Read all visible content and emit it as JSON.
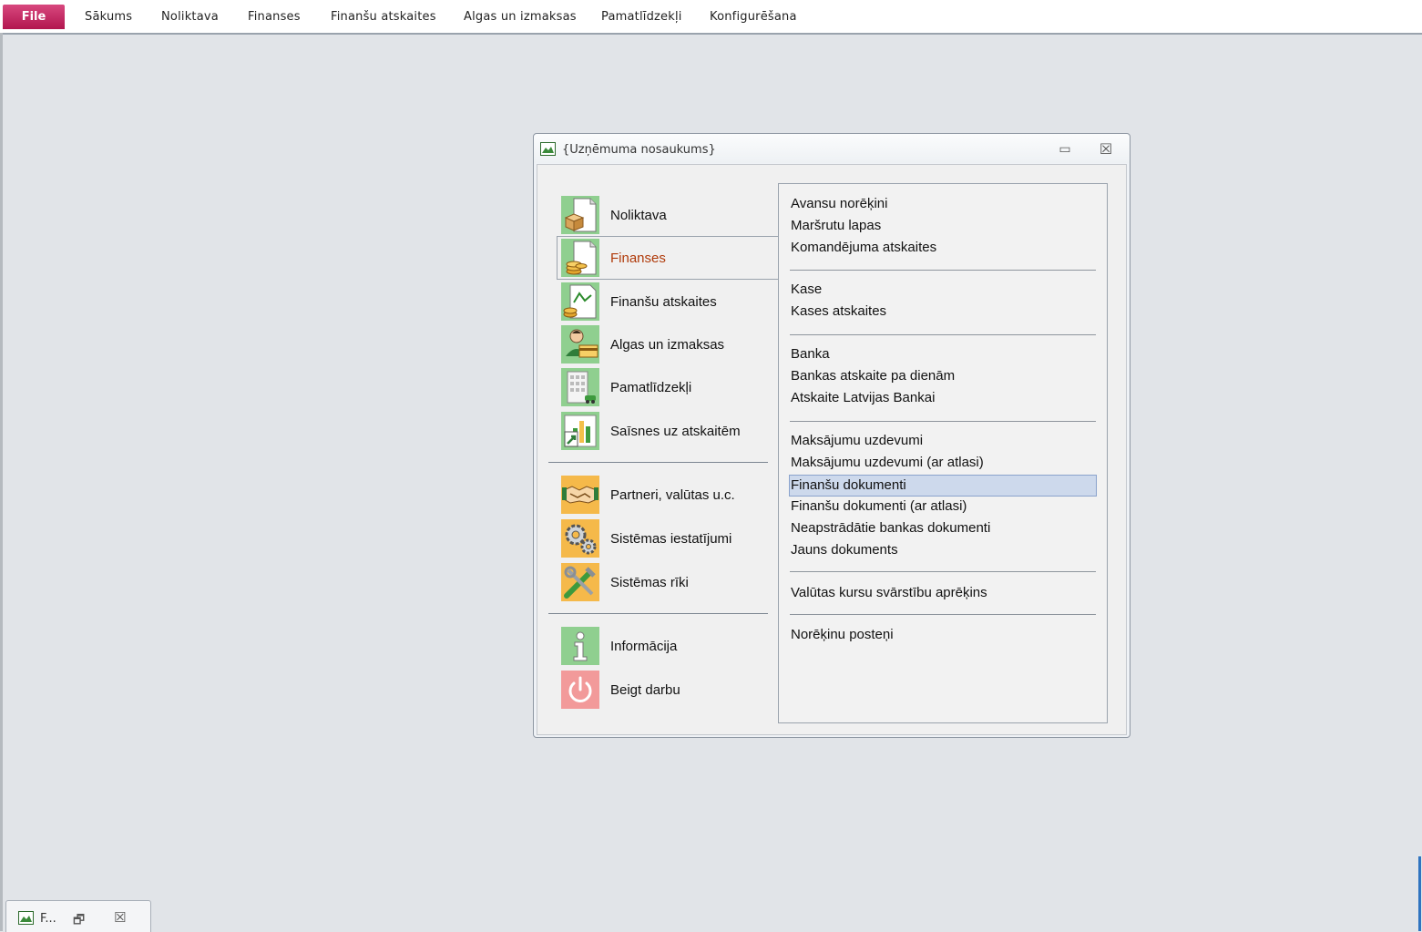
{
  "ribbon": {
    "file_label": "File",
    "tabs": [
      "Sākums",
      "Noliktava",
      "Finanses",
      "Finanšu atskaites",
      "Algas un izmaksas",
      "Pamatlīdzekļi",
      "Konfigurēšana"
    ]
  },
  "window": {
    "title": "{Uzņēmuma nosaukums}",
    "minimize_glyph": "▭",
    "close_glyph": "☒"
  },
  "nav": {
    "items": [
      {
        "label": "Noliktava",
        "icon": "warehouse-box-icon"
      },
      {
        "label": "Finanses",
        "icon": "finance-coins-icon"
      },
      {
        "label": "Finanšu atskaites",
        "icon": "finance-report-chart-icon"
      },
      {
        "label": "Algas un izmaksas",
        "icon": "salary-person-card-icon"
      },
      {
        "label": "Pamatlīdzekļi",
        "icon": "fixed-assets-building-icon"
      },
      {
        "label": "Saīsnes uz atskaitēm",
        "icon": "report-shortcut-icon"
      },
      {
        "label": "Partneri, valūtas u.c.",
        "icon": "handshake-icon"
      },
      {
        "label": "Sistēmas iestatījumi",
        "icon": "gears-icon"
      },
      {
        "label": "Sistēmas rīki",
        "icon": "tools-icon"
      },
      {
        "label": "Informācija",
        "icon": "info-icon"
      },
      {
        "label": "Beigt darbu",
        "icon": "power-icon"
      }
    ],
    "active": "Finanses"
  },
  "panel": {
    "links": [
      "Avansu norēķini",
      "Maršrutu lapas",
      "Komandējuma atskaites",
      "Kase",
      "Kases atskaites",
      "Banka",
      "Bankas atskaite pa dienām",
      "Atskaite Latvijas Bankai",
      "Maksājumu uzdevumi",
      "Maksājumu uzdevumi (ar atlasi)",
      "Finanšu dokumenti",
      "Finanšu dokumenti (ar atlasi)",
      "Neapstrādātie bankas dokumenti",
      "Jauns dokuments",
      "Valūtas kursu svārstību aprēķins",
      "Norēķinu posteņi"
    ],
    "selected": "Finanšu dokumenti"
  },
  "minimized": {
    "title": "F...",
    "restore_glyph": "🗗",
    "close_glyph": "☒"
  },
  "colors": {
    "file_tab": "#c51f5d",
    "selection": "#cdd9ec",
    "active_label": "#b03a0a",
    "icon_green_bg": "#8fcf8f",
    "icon_orange_bg": "#f5b94a",
    "icon_red_bg": "#f29a9a"
  }
}
